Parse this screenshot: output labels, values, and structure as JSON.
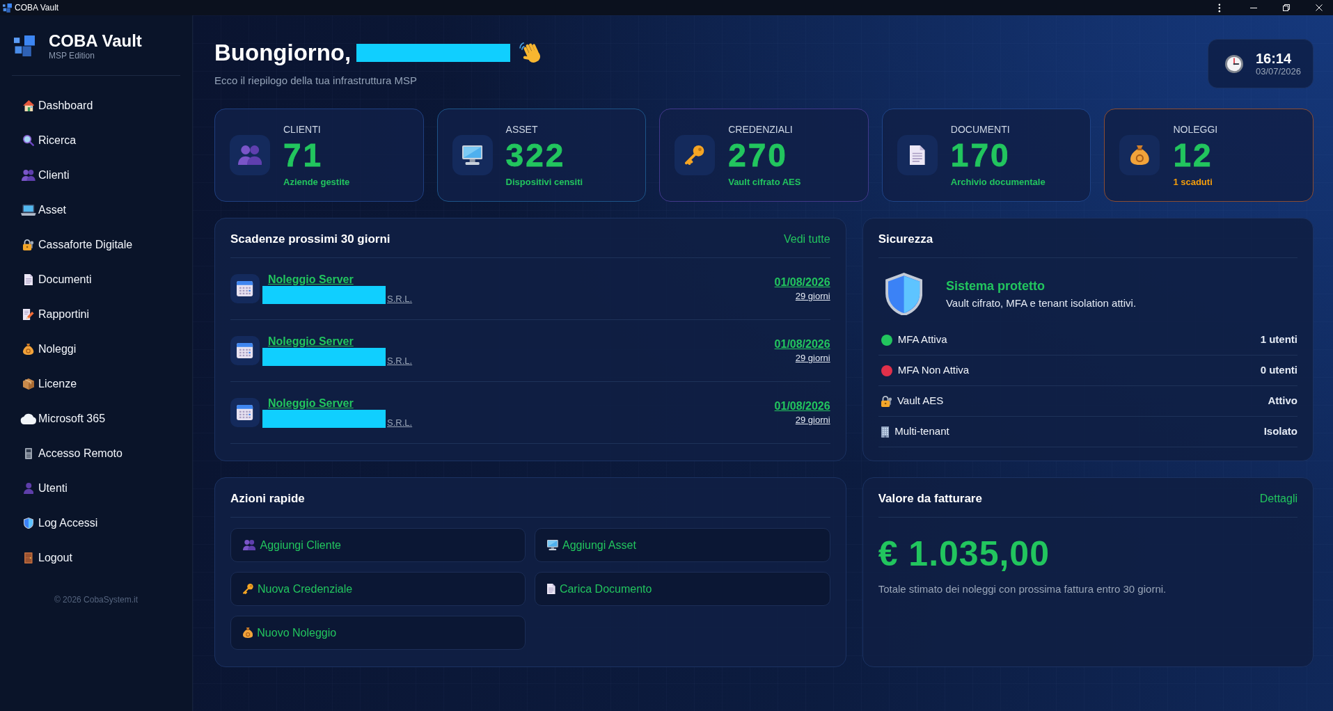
{
  "window": {
    "title": "COBA Vault"
  },
  "sidebar": {
    "brand": "COBA Vault",
    "edition": "MSP Edition",
    "items": [
      {
        "label": "Dashboard"
      },
      {
        "label": "Ricerca"
      },
      {
        "label": "Clienti"
      },
      {
        "label": "Asset"
      },
      {
        "label": "Cassaforte Digitale"
      },
      {
        "label": "Documenti"
      },
      {
        "label": "Rapportini"
      },
      {
        "label": "Noleggi"
      },
      {
        "label": "Licenze"
      },
      {
        "label": "Microsoft 365"
      },
      {
        "label": "Accesso Remoto"
      },
      {
        "label": "Utenti"
      },
      {
        "label": "Log Accessi"
      },
      {
        "label": "Logout"
      }
    ],
    "footer": "© 2026 CobaSystem.it"
  },
  "header": {
    "greeting": "Buongiorno,",
    "name_redacted": true,
    "subtitle": "Ecco il riepilogo della tua infrastruttura MSP",
    "clock": {
      "time": "16:14",
      "date": "03/07/2026"
    }
  },
  "stats": [
    {
      "label": "CLIENTI",
      "value": "71",
      "note": "Aziende gestite",
      "color": "#1f3f80",
      "warning": false
    },
    {
      "label": "ASSET",
      "value": "322",
      "note": "Dispositivi censiti",
      "color": "#1d5488",
      "warning": false
    },
    {
      "label": "CREDENZIALI",
      "value": "270",
      "note": "Vault cifrato AES",
      "color": "#41388a",
      "warning": false
    },
    {
      "label": "DOCUMENTI",
      "value": "170",
      "note": "Archivio documentale",
      "color": "#1f4488",
      "warning": false
    },
    {
      "label": "NOLEGGI",
      "value": "12",
      "note": "1 scaduti",
      "color": "#8a4c33",
      "warning": true
    }
  ],
  "deadlines": {
    "title": "Scadenze prossimi 30 giorni",
    "link": "Vedi tutte",
    "items": [
      {
        "title": "Noleggio Server",
        "client_redacted": true,
        "client_suffix": "S.R.L.",
        "date": "01/08/2026",
        "remaining": "29 giorni"
      },
      {
        "title": "Noleggio Server",
        "client_redacted": true,
        "client_suffix": "S.R.L.",
        "date": "01/08/2026",
        "remaining": "29 giorni"
      },
      {
        "title": "Noleggio Server",
        "client_redacted": true,
        "client_suffix": "S.R.L.",
        "date": "01/08/2026",
        "remaining": "29 giorni"
      }
    ]
  },
  "security": {
    "title": "Sicurezza",
    "status_title": "Sistema protetto",
    "status_text": "Vault cifrato, MFA e tenant isolation attivi.",
    "items": [
      {
        "kind": "dot",
        "color": "#22c55e",
        "label": "MFA Attiva",
        "value": "1 utenti"
      },
      {
        "kind": "dot",
        "color": "#e0304a",
        "label": "MFA Non Attiva",
        "value": "0 utenti"
      },
      {
        "kind": "lock",
        "label": "Vault AES",
        "value": "Attivo"
      },
      {
        "kind": "building",
        "label": "Multi-tenant",
        "value": "Isolato"
      }
    ]
  },
  "quick_actions": {
    "title": "Azioni rapide",
    "buttons": [
      {
        "label": "Aggiungi Cliente"
      },
      {
        "label": "Aggiungi Asset"
      },
      {
        "label": "Nuova Credenziale"
      },
      {
        "label": "Carica Documento"
      },
      {
        "label": "Nuovo Noleggio"
      }
    ]
  },
  "billing": {
    "title": "Valore da fatturare",
    "link": "Dettagli",
    "amount": "€ 1.035,00",
    "description": "Totale stimato dei noleggi con prossima fattura entro 30 giorni."
  }
}
